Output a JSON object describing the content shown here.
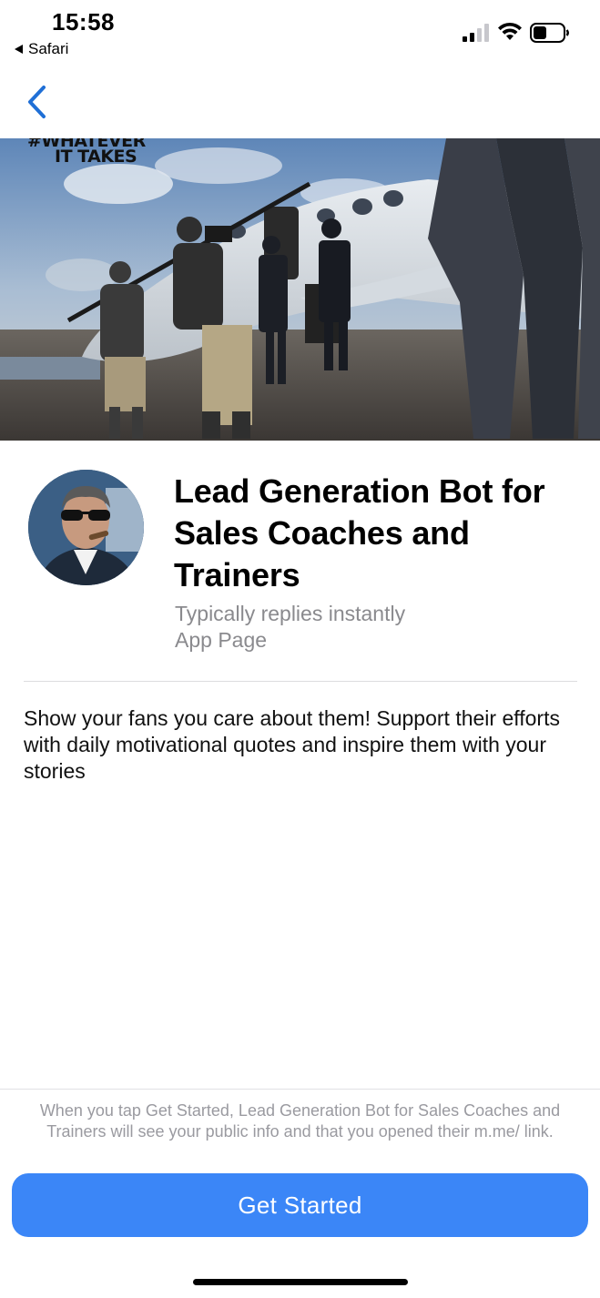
{
  "status_bar": {
    "time": "15:58",
    "back_app_label": "Safari",
    "icons": [
      "cellular-signal-icon",
      "wifi-icon",
      "battery-icon"
    ]
  },
  "nav": {
    "back_icon": "chevron-left-icon"
  },
  "hero": {
    "overlay_text_line1": "#WHATEVER",
    "overlay_text_line2": "IT TAKES"
  },
  "profile": {
    "title": "Lead Generation Bot for Sales Coaches and Trainers",
    "response_time": "Typically replies instantly",
    "category": "App Page"
  },
  "description": "Show your fans you care about them! Support their efforts with daily motivational quotes and inspire them with your stories",
  "footer": {
    "note": "When you tap Get Started, Lead Generation Bot for Sales Coaches and Trainers will see your public info and that you opened their m.me/ link.",
    "cta_label": "Get Started"
  },
  "colors": {
    "accent": "#3b86f7",
    "link": "#1f6fd6",
    "secondary_text": "#8a8a8e"
  }
}
